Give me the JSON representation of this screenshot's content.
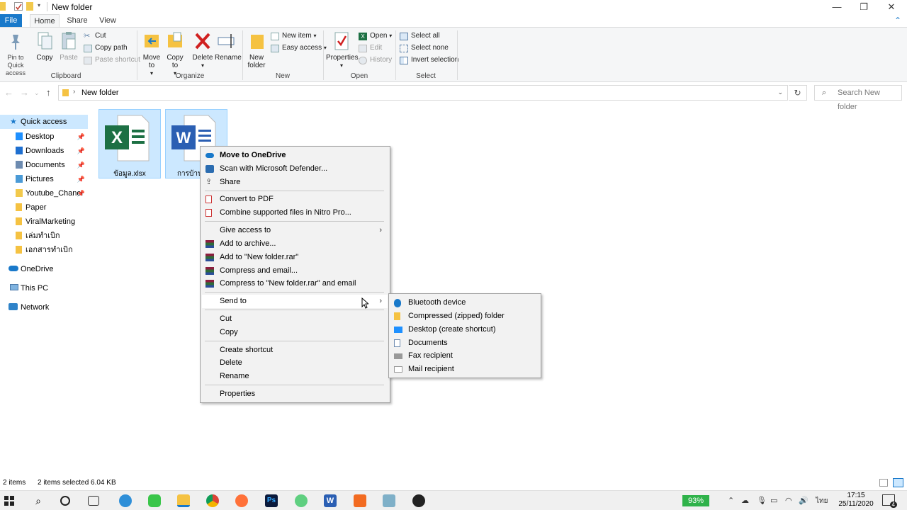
{
  "window": {
    "title": "New folder",
    "controls": {
      "minimize": "—",
      "maximize": "❐",
      "close": "✕"
    }
  },
  "ribbon_tabs": [
    "File",
    "Home",
    "Share",
    "View"
  ],
  "ribbon": {
    "clipboard": {
      "label": "Clipboard",
      "pin_quick_access": "Pin to Quick access",
      "copy": "Copy",
      "paste": "Paste",
      "cut": "Cut",
      "copy_path": "Copy path",
      "paste_shortcut": "Paste shortcut"
    },
    "organize": {
      "label": "Organize",
      "move_to": "Move to",
      "copy_to": "Copy to",
      "delete": "Delete",
      "rename": "Rename"
    },
    "new": {
      "label": "New",
      "new_folder": "New folder",
      "new_item": "New item",
      "easy_access": "Easy access"
    },
    "open": {
      "label": "Open",
      "properties": "Properties",
      "open": "Open",
      "edit": "Edit",
      "history": "History"
    },
    "select": {
      "label": "Select",
      "select_all": "Select all",
      "select_none": "Select none",
      "invert_selection": "Invert selection"
    }
  },
  "address": {
    "breadcrumb": "New folder",
    "search_placeholder": "Search New folder"
  },
  "nav_pane": {
    "quick_access": "Quick access",
    "pinned": [
      {
        "label": "Desktop",
        "color": "#1e90ff"
      },
      {
        "label": "Downloads",
        "color": "#1e6fd0"
      },
      {
        "label": "Documents",
        "color": "#6d8bb0"
      },
      {
        "label": "Pictures",
        "color": "#4a9ad6"
      },
      {
        "label": "Youtube_Chanel",
        "color": "#f2c94c"
      }
    ],
    "folders": [
      "Paper",
      "ViralMarketing",
      "เล่มทำเบิก",
      "เอกสารทำเบิก"
    ],
    "onedrive": "OneDrive",
    "this_pc": "This PC",
    "network": "Network"
  },
  "files": [
    {
      "name": "ข้อมูล.xlsx",
      "icon": "excel-icon",
      "color": "#1d7044"
    },
    {
      "name": "การบ้าน",
      "icon": "word-icon",
      "color": "#2b5fb3"
    }
  ],
  "context_menu": {
    "items": [
      "Move to OneDrive",
      "Scan with Microsoft Defender...",
      "Share",
      "Convert to PDF",
      "Combine supported files in Nitro Pro...",
      "Give access to",
      "Add to archive...",
      "Add to \"New folder.rar\"",
      "Compress and email...",
      "Compress to \"New folder.rar\" and email",
      "Send to",
      "Cut",
      "Copy",
      "Create shortcut",
      "Delete",
      "Rename",
      "Properties"
    ]
  },
  "send_to_menu": {
    "items": [
      "Bluetooth device",
      "Compressed (zipped) folder",
      "Desktop (create shortcut)",
      "Documents",
      "Fax recipient",
      "Mail recipient"
    ]
  },
  "status_bar": {
    "item_count": "2 items",
    "selection": "2 items selected  6.04 KB"
  },
  "taskbar": {
    "battery": "93%",
    "language": "ไทย",
    "time": "17:15",
    "date": "25/11/2020",
    "notifications": "4"
  },
  "colors": {
    "accent": "#1979ca",
    "selection": "#cce8ff",
    "menu_bg": "#f2f2f2",
    "battery_green": "#2fb24a"
  }
}
